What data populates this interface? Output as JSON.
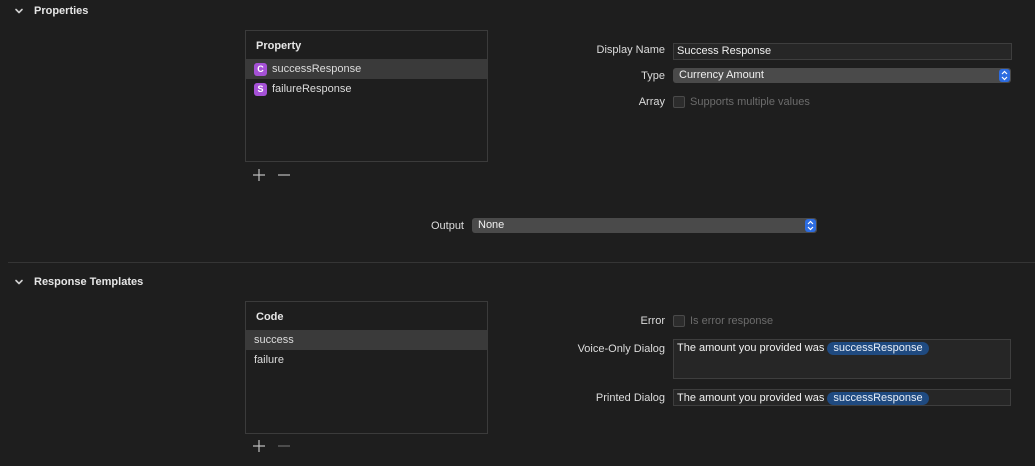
{
  "properties_section": {
    "title": "Properties",
    "table": {
      "header": "Property",
      "rows": [
        {
          "badge": "C",
          "label": "successResponse",
          "selected": true
        },
        {
          "badge": "S",
          "label": "failureResponse",
          "selected": false
        }
      ]
    },
    "display_name_label": "Display Name",
    "display_name_value": "Success Response",
    "type_label": "Type",
    "type_value": "Currency Amount",
    "array_label": "Array",
    "array_checkbox_label": "Supports multiple values",
    "output_label": "Output",
    "output_value": "None"
  },
  "templates_section": {
    "title": "Response Templates",
    "table": {
      "header": "Code",
      "rows": [
        {
          "label": "success",
          "selected": true
        },
        {
          "label": "failure",
          "selected": false
        }
      ]
    },
    "error_label": "Error",
    "error_checkbox_label": "Is error response",
    "voice_label": "Voice-Only Dialog",
    "voice_text": "The amount you provided was",
    "voice_token": "successResponse",
    "printed_label": "Printed Dialog",
    "printed_text": "The amount you provided was",
    "printed_token": "successResponse"
  },
  "colors": {
    "background": "#1e1e1e",
    "selection": "#3a3a3a",
    "badge": "#a551d6",
    "accent": "#2d6ce0",
    "token": "#1f4a80"
  },
  "icons": [
    "chevron-down-icon",
    "plus-icon",
    "minus-icon",
    "popup-stepper-icon"
  ]
}
